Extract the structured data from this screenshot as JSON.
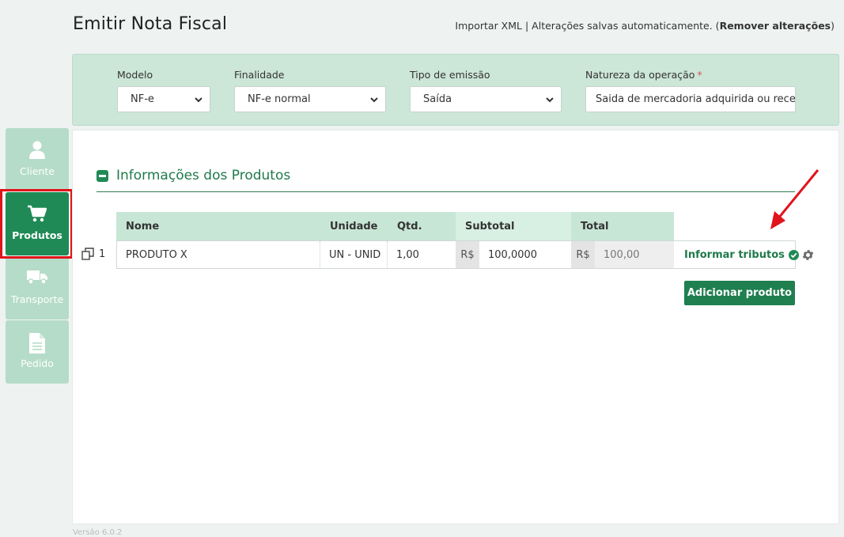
{
  "page": {
    "title": "Emitir Nota Fiscal",
    "import_xml": "Importar XML",
    "separator": " | ",
    "autosave_text": "Alterações salvas automaticamente. (",
    "remove_changes": "Remover alterações",
    "close_paren": ")"
  },
  "form": {
    "modelo": {
      "label": "Modelo",
      "value": "NF-e"
    },
    "finalidade": {
      "label": "Finalidade",
      "value": "NF-e normal"
    },
    "tipo_emissao": {
      "label": "Tipo de emissão",
      "value": "Saída"
    },
    "natureza": {
      "label": "Natureza da operação",
      "required_mark": "*",
      "value": "Saida de mercadoria adquirida ou recel"
    }
  },
  "sidebar": {
    "items": [
      {
        "label": "Cliente",
        "icon": "user-icon",
        "active": false
      },
      {
        "label": "Produtos",
        "icon": "cart-icon",
        "active": true
      },
      {
        "label": "Transporte",
        "icon": "truck-icon",
        "active": false
      },
      {
        "label": "Pedido",
        "icon": "document-icon",
        "active": false
      }
    ]
  },
  "products": {
    "section_title": "Informações dos Produtos",
    "columns": {
      "nome": "Nome",
      "unidade": "Unidade",
      "qtd": "Qtd.",
      "subtotal": "Subtotal",
      "total": "Total"
    },
    "rows": [
      {
        "index": "1",
        "nome": "PRODUTO X",
        "unidade": "UN - UNID",
        "qtd": "1,00",
        "currency": "R$",
        "subtotal": "100,0000",
        "total": "100,00",
        "tributos_link": "Informar tributos"
      }
    ],
    "add_button": "Adicionar produto"
  },
  "footer": {
    "version": "Versão 6.0.2"
  },
  "colors": {
    "primary": "#1f8a55",
    "panel": "#cce6d8",
    "highlight": "#e0141b"
  }
}
